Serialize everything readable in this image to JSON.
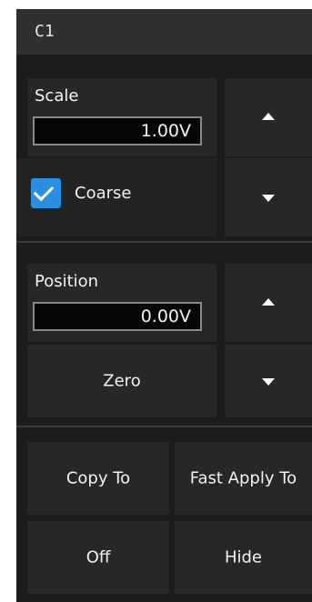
{
  "header": {
    "title": "C1"
  },
  "scale": {
    "label": "Scale",
    "value": "1.00V",
    "up_icon": "triangle-up",
    "down_icon": "triangle-down"
  },
  "coarse": {
    "label": "Coarse",
    "checked": true,
    "check_color": "#2a8fe0"
  },
  "position": {
    "label": "Position",
    "value": "0.00V",
    "up_icon": "triangle-up",
    "down_icon": "triangle-down"
  },
  "zero": {
    "label": "Zero"
  },
  "actions": {
    "copy_to": "Copy To",
    "fast_apply_to": "Fast Apply To",
    "off": "Off",
    "hide": "Hide"
  }
}
